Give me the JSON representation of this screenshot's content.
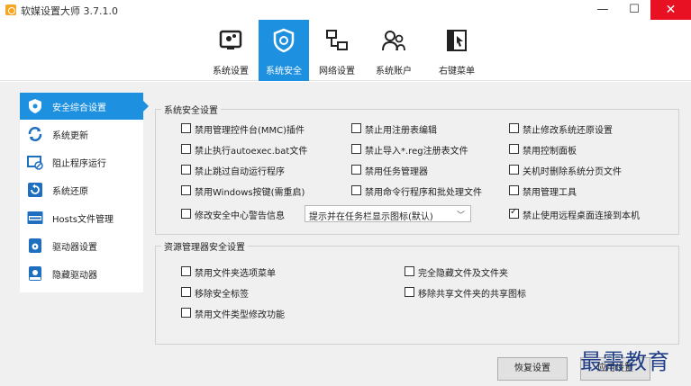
{
  "window": {
    "title": "软媒设置大师 3.7.1.0",
    "minimize": "—",
    "maximize": "☐",
    "close": "✕"
  },
  "toolbar": {
    "items": [
      {
        "label": "系统设置",
        "icon": "system-settings-icon"
      },
      {
        "label": "系统安全",
        "icon": "shield-icon",
        "active": true
      },
      {
        "label": "网络设置",
        "icon": "network-icon"
      },
      {
        "label": "系统账户",
        "icon": "users-icon"
      },
      {
        "label": "右键菜单",
        "icon": "cursor-icon"
      }
    ]
  },
  "sidebar": {
    "items": [
      {
        "label": "安全综合设置",
        "icon": "shield-icon",
        "active": true
      },
      {
        "label": "系统更新",
        "icon": "refresh-icon"
      },
      {
        "label": "阻止程序运行",
        "icon": "block-app-icon"
      },
      {
        "label": "系统还原",
        "icon": "restore-icon"
      },
      {
        "label": "Hosts文件管理",
        "icon": "hosts-file-icon"
      },
      {
        "label": "驱动器设置",
        "icon": "drive-icon"
      },
      {
        "label": "隐藏驱动器",
        "icon": "hidden-drive-icon"
      }
    ]
  },
  "security_group": {
    "title": "系统安全设置",
    "options": [
      {
        "label": "禁用管理控件台(MMC)插件",
        "checked": false
      },
      {
        "label": "禁止用注册表编辑",
        "checked": false
      },
      {
        "label": "禁止修改系统还原设置",
        "checked": false
      },
      {
        "label": "禁止执行autoexec.bat文件",
        "checked": false
      },
      {
        "label": "禁止导入*.reg注册表文件",
        "checked": false
      },
      {
        "label": "禁用控制面板",
        "checked": false
      },
      {
        "label": "禁止跳过自动运行程序",
        "checked": false
      },
      {
        "label": "禁用任务管理器",
        "checked": false
      },
      {
        "label": "关机时删除系统分页文件",
        "checked": false
      },
      {
        "label": "禁用Windows按键(需重启)",
        "checked": false
      },
      {
        "label": "禁用命令行程序和批处理文件",
        "checked": false
      },
      {
        "label": "禁用管理工具",
        "checked": false
      }
    ],
    "security_center": {
      "label": "修改安全中心警告信息",
      "checked": false
    },
    "security_center_select": "提示并在任务栏显示图标(默认)",
    "remote_desktop": {
      "label": "禁止使用远程桌面连接到本机",
      "checked": true
    }
  },
  "explorer_group": {
    "title": "资源管理器安全设置",
    "options": [
      {
        "label": "禁用文件夹选项菜单",
        "checked": false
      },
      {
        "label": "完全隐藏文件及文件夹",
        "checked": false
      },
      {
        "label": "移除安全标签",
        "checked": false
      },
      {
        "label": "移除共享文件夹的共享图标",
        "checked": false
      },
      {
        "label": "禁用文件类型修改功能",
        "checked": false
      }
    ]
  },
  "buttons": {
    "restore": "恢复设置",
    "apply": "应用设置"
  },
  "watermark": "最需教育",
  "colors": {
    "accent": "#1e90e0",
    "close": "#e81123",
    "background": "#f0f0f0"
  }
}
